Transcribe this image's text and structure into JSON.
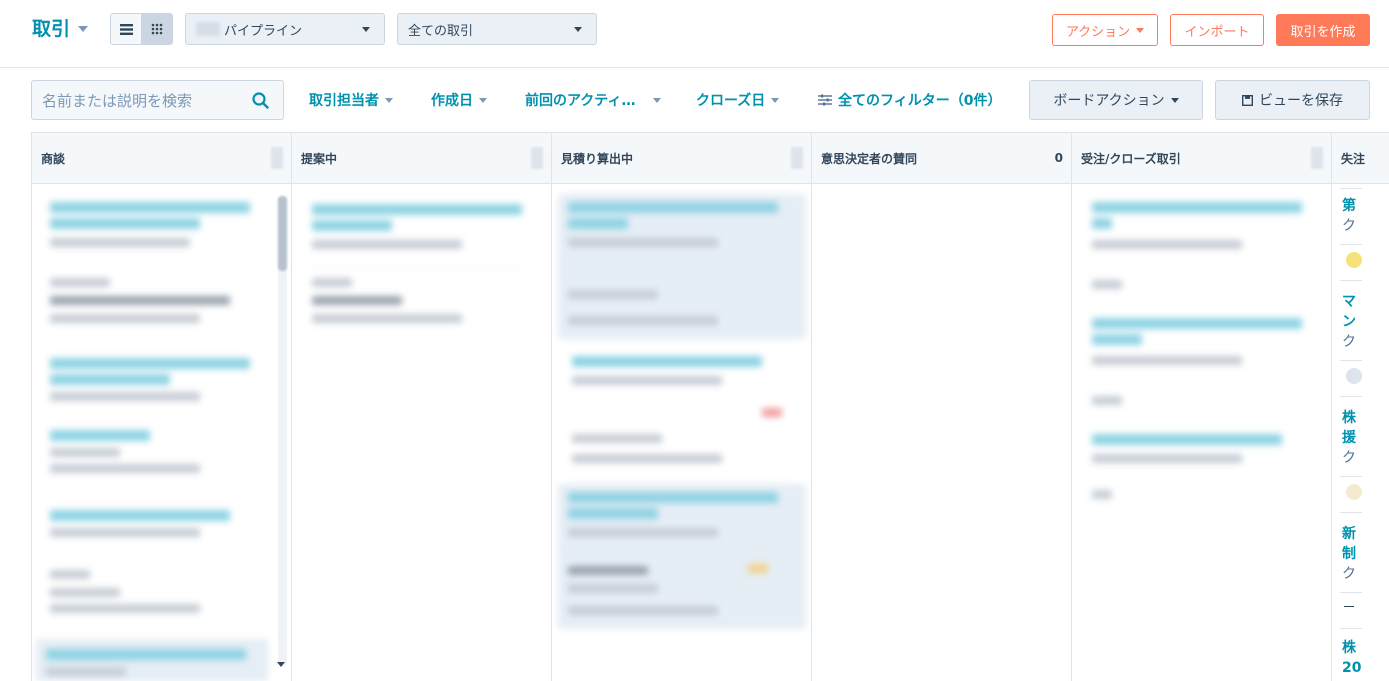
{
  "header": {
    "title": "取引",
    "pipeline_select": "パイプライン",
    "deals_select": "全ての取引",
    "actions_button": "アクション",
    "import_button": "インポート",
    "create_button": "取引を作成"
  },
  "filters": {
    "search_placeholder": "名前または説明を検索",
    "owner": "取引担当者",
    "created_date": "作成日",
    "last_activity": "前回のアクティ…",
    "close_date": "クローズ日",
    "all_filters": "全てのフィルター（0件）",
    "board_actions": "ボードアクション",
    "save_view": "ビューを保存"
  },
  "columns": [
    {
      "label": "商談",
      "count": ""
    },
    {
      "label": "提案中",
      "count": ""
    },
    {
      "label": "見積り算出中",
      "count": ""
    },
    {
      "label": "意思決定者の賛同",
      "count": "0"
    },
    {
      "label": "受注/クローズ取引",
      "count": ""
    },
    {
      "label": "失注",
      "count": ""
    }
  ],
  "lost_column_cards": [
    {
      "title": "第",
      "sub": "ク"
    },
    {
      "title": "マ",
      "title2": "ン",
      "sub": "ク"
    },
    {
      "title": "株",
      "title2": "援",
      "sub": "ク"
    },
    {
      "title": "新",
      "title2": "制",
      "sub": "ク"
    },
    {
      "title": "株",
      "title2": "20"
    }
  ],
  "icons": {
    "list_view": "list-icon",
    "board_view": "grid-icon",
    "search": "search-icon",
    "filter": "sliders-icon",
    "save": "save-icon"
  },
  "colors": {
    "accent": "#0091ae",
    "primary_button": "#ff7a59",
    "text": "#33475b",
    "border": "#cbd6e2"
  }
}
